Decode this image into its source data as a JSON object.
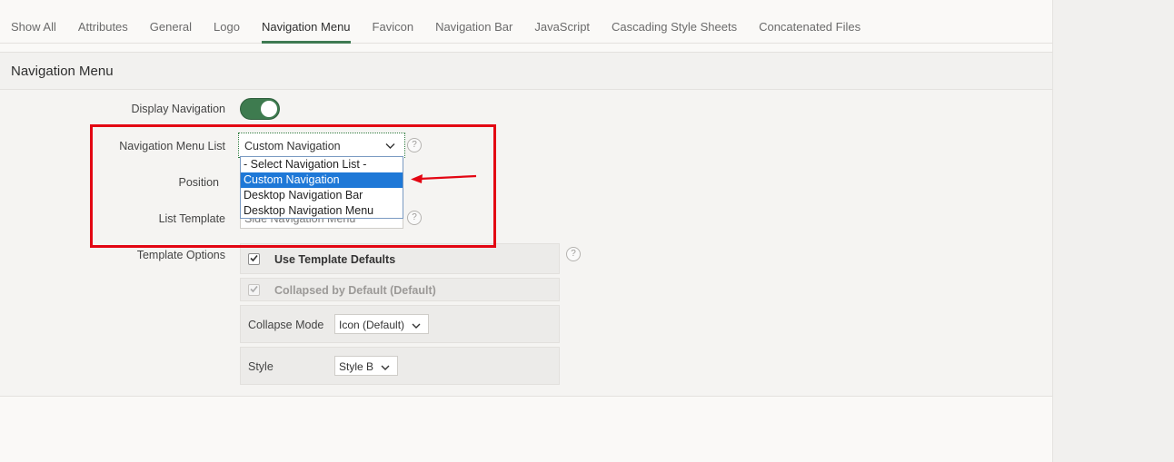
{
  "tabs": [
    {
      "label": "Show All",
      "active": false
    },
    {
      "label": "Attributes",
      "active": false
    },
    {
      "label": "General",
      "active": false
    },
    {
      "label": "Logo",
      "active": false
    },
    {
      "label": "Navigation Menu",
      "active": true
    },
    {
      "label": "Favicon",
      "active": false
    },
    {
      "label": "Navigation Bar",
      "active": false
    },
    {
      "label": "JavaScript",
      "active": false
    },
    {
      "label": "Cascading Style Sheets",
      "active": false
    },
    {
      "label": "Concatenated Files",
      "active": false
    }
  ],
  "region": {
    "title": "Navigation Menu"
  },
  "form": {
    "display_navigation_label": "Display Navigation",
    "display_navigation_on": true,
    "nav_menu_list_label": "Navigation Menu List",
    "nav_menu_list_value": "Custom Navigation",
    "position_label": "Position",
    "list_template_label": "List Template",
    "list_template_value": "Side Navigation Menu",
    "template_options_label": "Template Options",
    "help_glyph": "?"
  },
  "dropdown": {
    "options": [
      {
        "label": "- Select Navigation List -",
        "selected": false
      },
      {
        "label": "Custom Navigation",
        "selected": true
      },
      {
        "label": "Desktop Navigation Bar",
        "selected": false
      },
      {
        "label": "Desktop Navigation Menu",
        "selected": false
      }
    ]
  },
  "template_options": {
    "use_defaults_label": "Use Template Defaults",
    "use_defaults_checked": true,
    "collapsed_label": "Collapsed by Default (Default)",
    "collapsed_checked": true,
    "collapse_mode_label": "Collapse Mode",
    "collapse_mode_value": "Icon (Default)",
    "style_label": "Style",
    "style_value": "Style B"
  },
  "colors": {
    "accent": "#3f7a52",
    "selection": "#1e78d7",
    "annotation": "#e30613"
  },
  "icons": {
    "chevron": "chevron-down-icon",
    "help": "help-icon",
    "check": "check-icon"
  }
}
